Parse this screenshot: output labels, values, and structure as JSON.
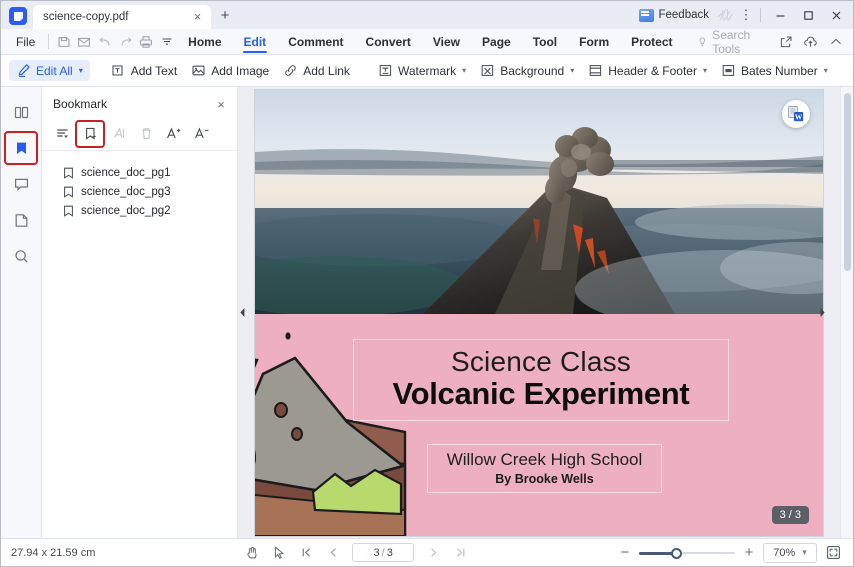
{
  "titlebar": {
    "logo_icon": "pdfelement-logo-icon",
    "tab_label": "science-copy.pdf",
    "tab_close_glyph": "×",
    "new_tab_glyph": "+",
    "feedback_label": "Feedback",
    "feedback_icon": "feedback-icon",
    "decoration_icon": "decorative-graphic-icon",
    "more_glyph": "⋮",
    "minimize_icon": "minimize-icon",
    "maximize_icon": "maximize-icon",
    "close_icon": "close-icon"
  },
  "menubar": {
    "file_label": "File",
    "quick_icons": [
      {
        "name": "save-icon"
      },
      {
        "name": "email-icon"
      },
      {
        "name": "undo-icon"
      },
      {
        "name": "redo-icon"
      },
      {
        "name": "print-icon"
      },
      {
        "name": "customize-toolbar-icon"
      }
    ],
    "tabs": [
      {
        "label": "Home",
        "active": false
      },
      {
        "label": "Edit",
        "active": true
      },
      {
        "label": "Comment",
        "active": false
      },
      {
        "label": "Convert",
        "active": false
      },
      {
        "label": "View",
        "active": false
      },
      {
        "label": "Page",
        "active": false
      },
      {
        "label": "Tool",
        "active": false
      },
      {
        "label": "Form",
        "active": false
      },
      {
        "label": "Protect",
        "active": false
      }
    ],
    "search_placeholder": "Search Tools",
    "search_icon": "search-tools-icon",
    "right_icons": [
      {
        "name": "share-icon"
      },
      {
        "name": "cloud-upload-icon"
      },
      {
        "name": "collapse-ribbon-icon"
      }
    ]
  },
  "ribbon": {
    "items": [
      {
        "label": "Edit All",
        "icon": "edit-all-icon",
        "caret": true,
        "selected": true
      },
      {
        "label": "Add Text",
        "icon": "add-text-icon",
        "caret": false,
        "selected": false
      },
      {
        "label": "Add Image",
        "icon": "add-image-icon",
        "caret": false,
        "selected": false
      },
      {
        "label": "Add Link",
        "icon": "add-link-icon",
        "caret": false,
        "selected": false
      },
      {
        "label": "Watermark",
        "icon": "watermark-icon",
        "caret": true,
        "selected": false
      },
      {
        "label": "Background",
        "icon": "background-icon",
        "caret": true,
        "selected": false
      },
      {
        "label": "Header & Footer",
        "icon": "header-footer-icon",
        "caret": true,
        "selected": false
      },
      {
        "label": "Bates Number",
        "icon": "bates-number-icon",
        "caret": true,
        "selected": false
      }
    ],
    "overflow_glyph": "›",
    "caret_glyph": "▾"
  },
  "rail": {
    "items": [
      {
        "name": "thumbnails-panel-icon",
        "active": false,
        "highlighted": false
      },
      {
        "name": "bookmark-panel-icon",
        "active": true,
        "highlighted": true
      },
      {
        "name": "comment-panel-icon",
        "active": false,
        "highlighted": false
      },
      {
        "name": "attachment-panel-icon",
        "active": false,
        "highlighted": false
      },
      {
        "name": "search-panel-icon",
        "active": false,
        "highlighted": false
      }
    ]
  },
  "bookmark_panel": {
    "title": "Bookmark",
    "close_glyph": "×",
    "tools": [
      {
        "name": "expand-collapse-bookmarks-icon",
        "disabled": false,
        "highlighted": false
      },
      {
        "name": "add-bookmark-icon",
        "disabled": false,
        "highlighted": true
      },
      {
        "name": "rename-bookmark-icon",
        "disabled": true,
        "highlighted": false
      },
      {
        "name": "delete-bookmark-icon",
        "disabled": true,
        "highlighted": false
      },
      {
        "name": "increase-font-size-icon",
        "disabled": false,
        "highlighted": false
      },
      {
        "name": "decrease-font-size-icon",
        "disabled": false,
        "highlighted": false
      }
    ],
    "bookmarks": [
      {
        "label": "science_doc_pg1"
      },
      {
        "label": "science_doc_pg3"
      },
      {
        "label": "science_doc_pg2"
      }
    ]
  },
  "document": {
    "collapse_left_glyph": "◀",
    "collapse_right_glyph": "▶",
    "convert_to_word_icon": "convert-to-word-icon",
    "page_badge": "3 / 3",
    "photo_alt": "erupting-volcano-photo",
    "illustration_alt": "volcano-cross-section-illustration",
    "title_line1": "Science Class",
    "title_line2": "Volcanic Experiment",
    "subtitle_school": "Willow Creek High School",
    "subtitle_author": "By Brooke Wells",
    "background_color": "#eeafc0"
  },
  "statusbar": {
    "dimensions": "27.94 x 21.59 cm",
    "tools": [
      {
        "name": "hand-tool-icon"
      },
      {
        "name": "select-tool-icon"
      }
    ],
    "first_page_icon": "first-page-icon",
    "prev_page_icon": "prev-page-icon",
    "next_page_icon": "next-page-icon",
    "last_page_icon": "last-page-icon",
    "current_page": "3",
    "page_separator": "/",
    "total_pages": "3",
    "zoom_out_glyph": "−",
    "zoom_in_glyph": "+",
    "zoom_level": "70%",
    "zoom_caret_glyph": "⌄",
    "fit_page_icon": "fit-page-icon"
  }
}
